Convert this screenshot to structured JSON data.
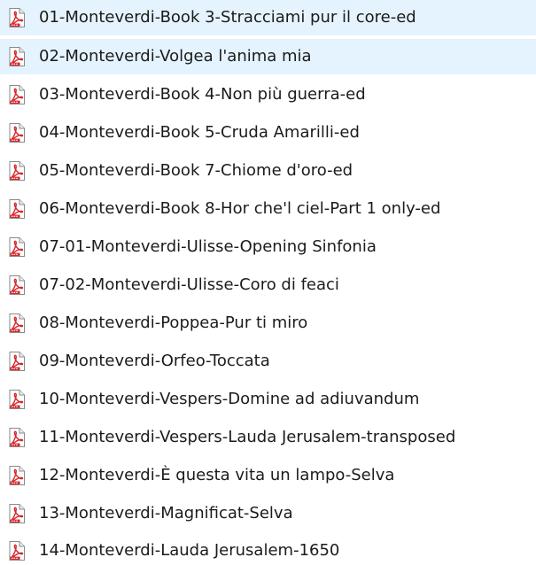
{
  "explorer": {
    "selected_index": 1,
    "colors": {
      "selection_bg": "#e5f3ff",
      "text": "#1b1b1b",
      "pdf_red": "#d6262b"
    },
    "items": [
      {
        "name": "01-Monteverdi-Book 3-Stracciami pur il core-ed",
        "icon": "pdf-file-icon"
      },
      {
        "name": "02-Monteverdi-Volgea l'anima mia",
        "icon": "pdf-file-icon"
      },
      {
        "name": "03-Monteverdi-Book 4-Non più guerra-ed",
        "icon": "pdf-file-icon"
      },
      {
        "name": "04-Monteverdi-Book 5-Cruda Amarilli-ed",
        "icon": "pdf-file-icon"
      },
      {
        "name": "05-Monteverdi-Book 7-Chiome d'oro-ed",
        "icon": "pdf-file-icon"
      },
      {
        "name": "06-Monteverdi-Book 8-Hor che'l ciel-Part 1 only-ed",
        "icon": "pdf-file-icon"
      },
      {
        "name": "07-01-Monteverdi-Ulisse-Opening Sinfonia",
        "icon": "pdf-file-icon"
      },
      {
        "name": "07-02-Monteverdi-Ulisse-Coro di feaci",
        "icon": "pdf-file-icon"
      },
      {
        "name": "08-Monteverdi-Poppea-Pur ti miro",
        "icon": "pdf-file-icon"
      },
      {
        "name": "09-Monteverdi-Orfeo-Toccata",
        "icon": "pdf-file-icon"
      },
      {
        "name": "10-Monteverdi-Vespers-Domine ad adiuvandum",
        "icon": "pdf-file-icon"
      },
      {
        "name": "11-Monteverdi-Vespers-Lauda Jerusalem-transposed",
        "icon": "pdf-file-icon"
      },
      {
        "name": "12-Monteverdi-È questa vita un lampo-Selva",
        "icon": "pdf-file-icon"
      },
      {
        "name": "13-Monteverdi-Magnificat-Selva",
        "icon": "pdf-file-icon"
      },
      {
        "name": "14-Monteverdi-Lauda Jerusalem-1650",
        "icon": "pdf-file-icon"
      }
    ]
  }
}
